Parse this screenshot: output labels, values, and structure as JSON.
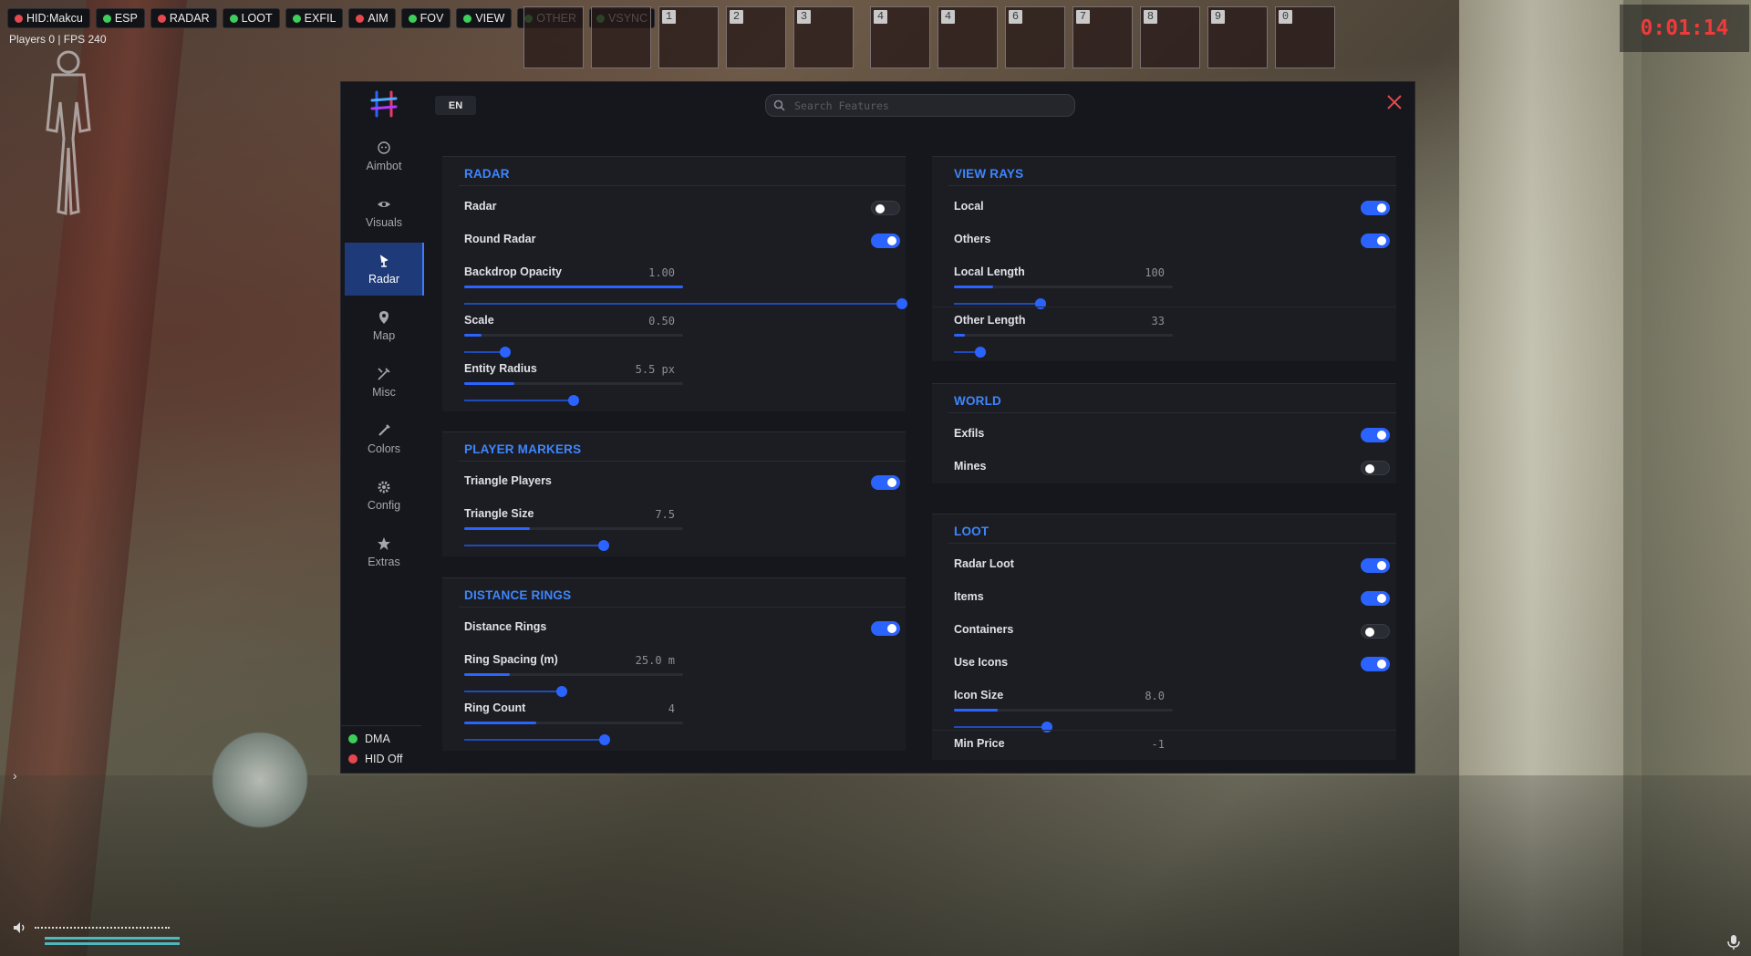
{
  "hud": {
    "chips": [
      {
        "label": "HID:Makcu",
        "color": "#e5484d"
      },
      {
        "label": "ESP",
        "color": "#3ecf5a"
      },
      {
        "label": "RADAR",
        "color": "#e5484d"
      },
      {
        "label": "LOOT",
        "color": "#3ecf5a"
      },
      {
        "label": "EXFIL",
        "color": "#3ecf5a"
      },
      {
        "label": "AIM",
        "color": "#e5484d"
      },
      {
        "label": "FOV",
        "color": "#3ecf5a"
      },
      {
        "label": "VIEW",
        "color": "#3ecf5a"
      },
      {
        "label": "OTHER",
        "color": "#3ecf5a"
      },
      {
        "label": "VSYNC",
        "color": "#3ecf5a"
      }
    ],
    "players_text": "Players 0 | FPS 240",
    "timer": "0:01:14",
    "hotbar_slots": [
      "",
      "",
      "1",
      "2",
      "3",
      "4",
      "4",
      "6",
      "7",
      "8",
      "9",
      "0"
    ]
  },
  "window": {
    "language": "EN",
    "search_placeholder": "Search Features",
    "sidebar": [
      {
        "label": "Aimbot",
        "icon": "aimbot-icon",
        "active": false
      },
      {
        "label": "Visuals",
        "icon": "eye-icon",
        "active": false
      },
      {
        "label": "Radar",
        "icon": "radar-icon",
        "active": true
      },
      {
        "label": "Map",
        "icon": "map-pin-icon",
        "active": false
      },
      {
        "label": "Misc",
        "icon": "wrench-icon",
        "active": false
      },
      {
        "label": "Colors",
        "icon": "brush-icon",
        "active": false
      },
      {
        "label": "Config",
        "icon": "gear-icon",
        "active": false
      },
      {
        "label": "Extras",
        "icon": "star-icon",
        "active": false
      }
    ],
    "status": {
      "dma": {
        "label": "DMA",
        "color": "#3ecf5a"
      },
      "hid": {
        "label": "HID Off",
        "color": "#e5484d"
      }
    },
    "radar": {
      "title": "RADAR",
      "radar_label": "Radar",
      "radar_on": false,
      "round_label": "Round Radar",
      "round_on": true,
      "backdrop_label": "Backdrop Opacity",
      "backdrop_value": "1.00",
      "backdrop_level": 1.0,
      "scale_label": "Scale",
      "scale_value": "0.50",
      "scale_level": 0.08,
      "entity_label": "Entity Radius",
      "entity_value": "5.5 px",
      "entity_level": 0.23
    },
    "player_markers": {
      "title": "PLAYER MARKERS",
      "triangle_label": "Triangle Players",
      "triangle_on": true,
      "size_label": "Triangle Size",
      "size_value": "7.5",
      "size_level": 0.3
    },
    "distance_rings": {
      "title": "DISTANCE RINGS",
      "rings_label": "Distance Rings",
      "rings_on": true,
      "spacing_label": "Ring Spacing (m)",
      "spacing_value": "25.0 m",
      "spacing_level": 0.21,
      "count_label": "Ring Count",
      "count_value": "4",
      "count_level": 0.33
    },
    "view_rays": {
      "title": "VIEW RAYS",
      "local_label": "Local",
      "local_on": true,
      "others_label": "Others",
      "others_on": true,
      "local_length_label": "Local Length",
      "local_length_value": "100",
      "local_length_level": 0.18,
      "other_length_label": "Other Length",
      "other_length_value": "33",
      "other_length_level": 0.05
    },
    "world": {
      "title": "WORLD",
      "exfils_label": "Exfils",
      "exfils_on": true,
      "mines_label": "Mines",
      "mines_on": false
    },
    "loot": {
      "title": "LOOT",
      "radar_loot_label": "Radar Loot",
      "radar_loot_on": true,
      "items_label": "Items",
      "items_on": true,
      "containers_label": "Containers",
      "containers_on": false,
      "icons_label": "Use Icons",
      "icons_on": true,
      "icon_size_label": "Icon Size",
      "icon_size_value": "8.0",
      "icon_size_level": 0.2,
      "min_price_label": "Min Price",
      "min_price_value": "-1"
    }
  }
}
